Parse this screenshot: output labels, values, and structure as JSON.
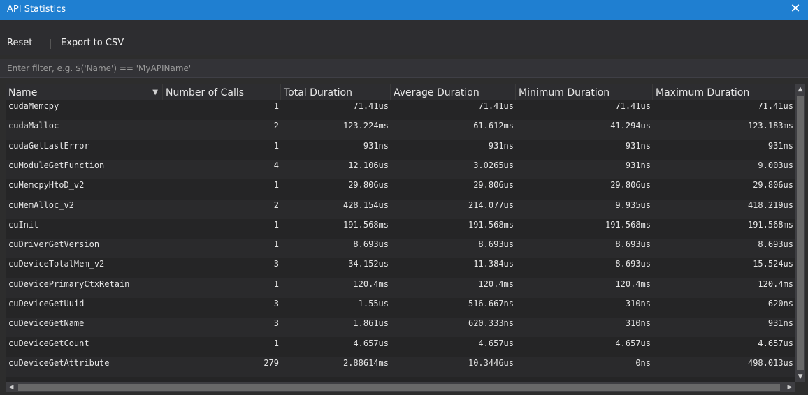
{
  "window": {
    "title": "API Statistics",
    "close_glyph": "✕"
  },
  "toolbar": {
    "reset_label": "Reset",
    "export_label": "Export to CSV"
  },
  "filter": {
    "placeholder": "Enter filter, e.g. $('Name') == 'MyAPIName'",
    "value": ""
  },
  "table": {
    "columns": [
      "Name",
      "Number of Calls",
      "Total Duration",
      "Average Duration",
      "Minimum Duration",
      "Maximum Duration"
    ],
    "sort_column": "Name",
    "sort_direction": "descending",
    "rows": [
      [
        "cudaMemcpy",
        "1",
        "71.41us",
        "71.41us",
        "71.41us",
        "71.41us"
      ],
      [
        "cudaMalloc",
        "2",
        "123.224ms",
        "61.612ms",
        "41.294us",
        "123.183ms"
      ],
      [
        "cudaGetLastError",
        "1",
        "931ns",
        "931ns",
        "931ns",
        "931ns"
      ],
      [
        "cuModuleGetFunction",
        "4",
        "12.106us",
        "3.0265us",
        "931ns",
        "9.003us"
      ],
      [
        "cuMemcpyHtoD_v2",
        "1",
        "29.806us",
        "29.806us",
        "29.806us",
        "29.806us"
      ],
      [
        "cuMemAlloc_v2",
        "2",
        "428.154us",
        "214.077us",
        "9.935us",
        "418.219us"
      ],
      [
        "cuInit",
        "1",
        "191.568ms",
        "191.568ms",
        "191.568ms",
        "191.568ms"
      ],
      [
        "cuDriverGetVersion",
        "1",
        "8.693us",
        "8.693us",
        "8.693us",
        "8.693us"
      ],
      [
        "cuDeviceTotalMem_v2",
        "3",
        "34.152us",
        "11.384us",
        "8.693us",
        "15.524us"
      ],
      [
        "cuDevicePrimaryCtxRetain",
        "1",
        "120.4ms",
        "120.4ms",
        "120.4ms",
        "120.4ms"
      ],
      [
        "cuDeviceGetUuid",
        "3",
        "1.55us",
        "516.667ns",
        "310ns",
        "620ns"
      ],
      [
        "cuDeviceGetName",
        "3",
        "1.861us",
        "620.333ns",
        "310ns",
        "931ns"
      ],
      [
        "cuDeviceGetCount",
        "1",
        "4.657us",
        "4.657us",
        "4.657us",
        "4.657us"
      ],
      [
        "cuDeviceGetAttribute",
        "279",
        "2.88614ms",
        "10.3446us",
        "0ns",
        "498.013us"
      ]
    ]
  },
  "colors": {
    "titlebar": "#1f7fd1",
    "background": "#2d2d30",
    "grid": "#252526",
    "text": "#e6e6e6"
  },
  "icons": {
    "close": "close-icon",
    "sort": "sort-down-icon",
    "scroll_up": "arrow-up-icon",
    "scroll_down": "arrow-down-icon",
    "scroll_left": "arrow-left-icon",
    "scroll_right": "arrow-right-icon"
  }
}
